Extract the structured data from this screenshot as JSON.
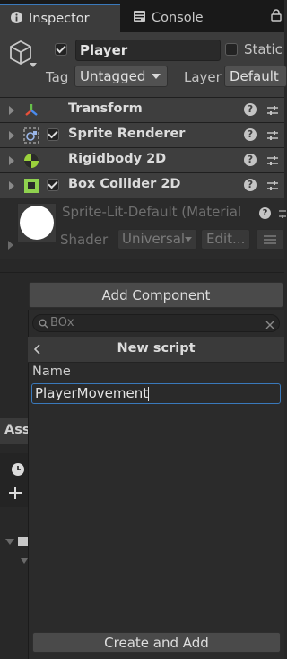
{
  "tabs": [
    {
      "label": "Inspector",
      "icon": "info-icon",
      "active": true
    },
    {
      "label": "Console",
      "icon": "console-icon",
      "active": false
    }
  ],
  "header": {
    "object_name": "Player",
    "static_label": "Static",
    "tag_label": "Tag",
    "tag_value": "Untagged",
    "layer_label": "Layer",
    "layer_value": "Default"
  },
  "components": [
    {
      "name": "Transform",
      "icon": "transform-icon",
      "has_checkbox": false
    },
    {
      "name": "Sprite Renderer",
      "icon": "sprite-renderer-icon",
      "has_checkbox": true,
      "checked": true
    },
    {
      "name": "Rigidbody 2D",
      "icon": "rigidbody-icon",
      "has_checkbox": false
    },
    {
      "name": "Box Collider 2D",
      "icon": "box-collider-icon",
      "has_checkbox": true,
      "checked": true
    }
  ],
  "material": {
    "name": "Sprite-Lit-Default (Material",
    "shader_label": "Shader",
    "shader_value": "Universal",
    "edit_label": "Edit..."
  },
  "add_component_label": "Add Component",
  "popup": {
    "search_value": "BOx",
    "title": "New script",
    "name_label": "Name",
    "name_value": "PlayerMovement",
    "create_label": "Create and Add"
  },
  "background": {
    "assets_tab_partial": "Ass"
  },
  "colors": {
    "accent": "#3a79bb",
    "rigidbody_green": "#9bd23c",
    "collider_green": "#8fd14f"
  }
}
